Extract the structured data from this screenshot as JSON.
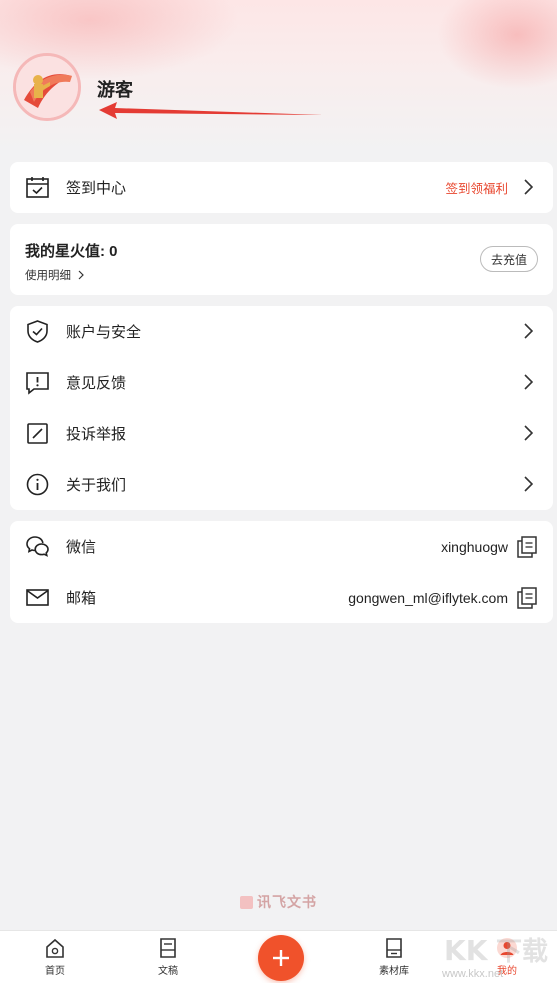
{
  "profile": {
    "username": "游客"
  },
  "checkin": {
    "label": "签到中心",
    "right": "签到领福利"
  },
  "spark": {
    "title": "我的星火值: 0",
    "detail": "使用明细",
    "recharge": "去充值"
  },
  "menu": [
    {
      "label": "账户与安全",
      "icon": "shield-check-icon"
    },
    {
      "label": "意见反馈",
      "icon": "feedback-icon"
    },
    {
      "label": "投诉举报",
      "icon": "report-icon"
    },
    {
      "label": "关于我们",
      "icon": "info-icon"
    }
  ],
  "contact": [
    {
      "label": "微信",
      "value": "xinghuogw",
      "icon": "wechat-icon"
    },
    {
      "label": "邮箱",
      "value": "gongwen_ml@iflytek.com",
      "icon": "mail-icon"
    }
  ],
  "footer": {
    "brand": "讯飞文书"
  },
  "tabs": [
    {
      "label": "首页",
      "icon": "home-icon"
    },
    {
      "label": "文稿",
      "icon": "document-icon"
    },
    {
      "label": "素材库",
      "icon": "library-icon"
    },
    {
      "label": "我的",
      "icon": "profile-icon"
    }
  ],
  "watermark": {
    "text": "www.kkx.net"
  },
  "colors": {
    "accent": "#f0522b",
    "accent_text": "#e8472f",
    "background": "#f2f2f3"
  }
}
